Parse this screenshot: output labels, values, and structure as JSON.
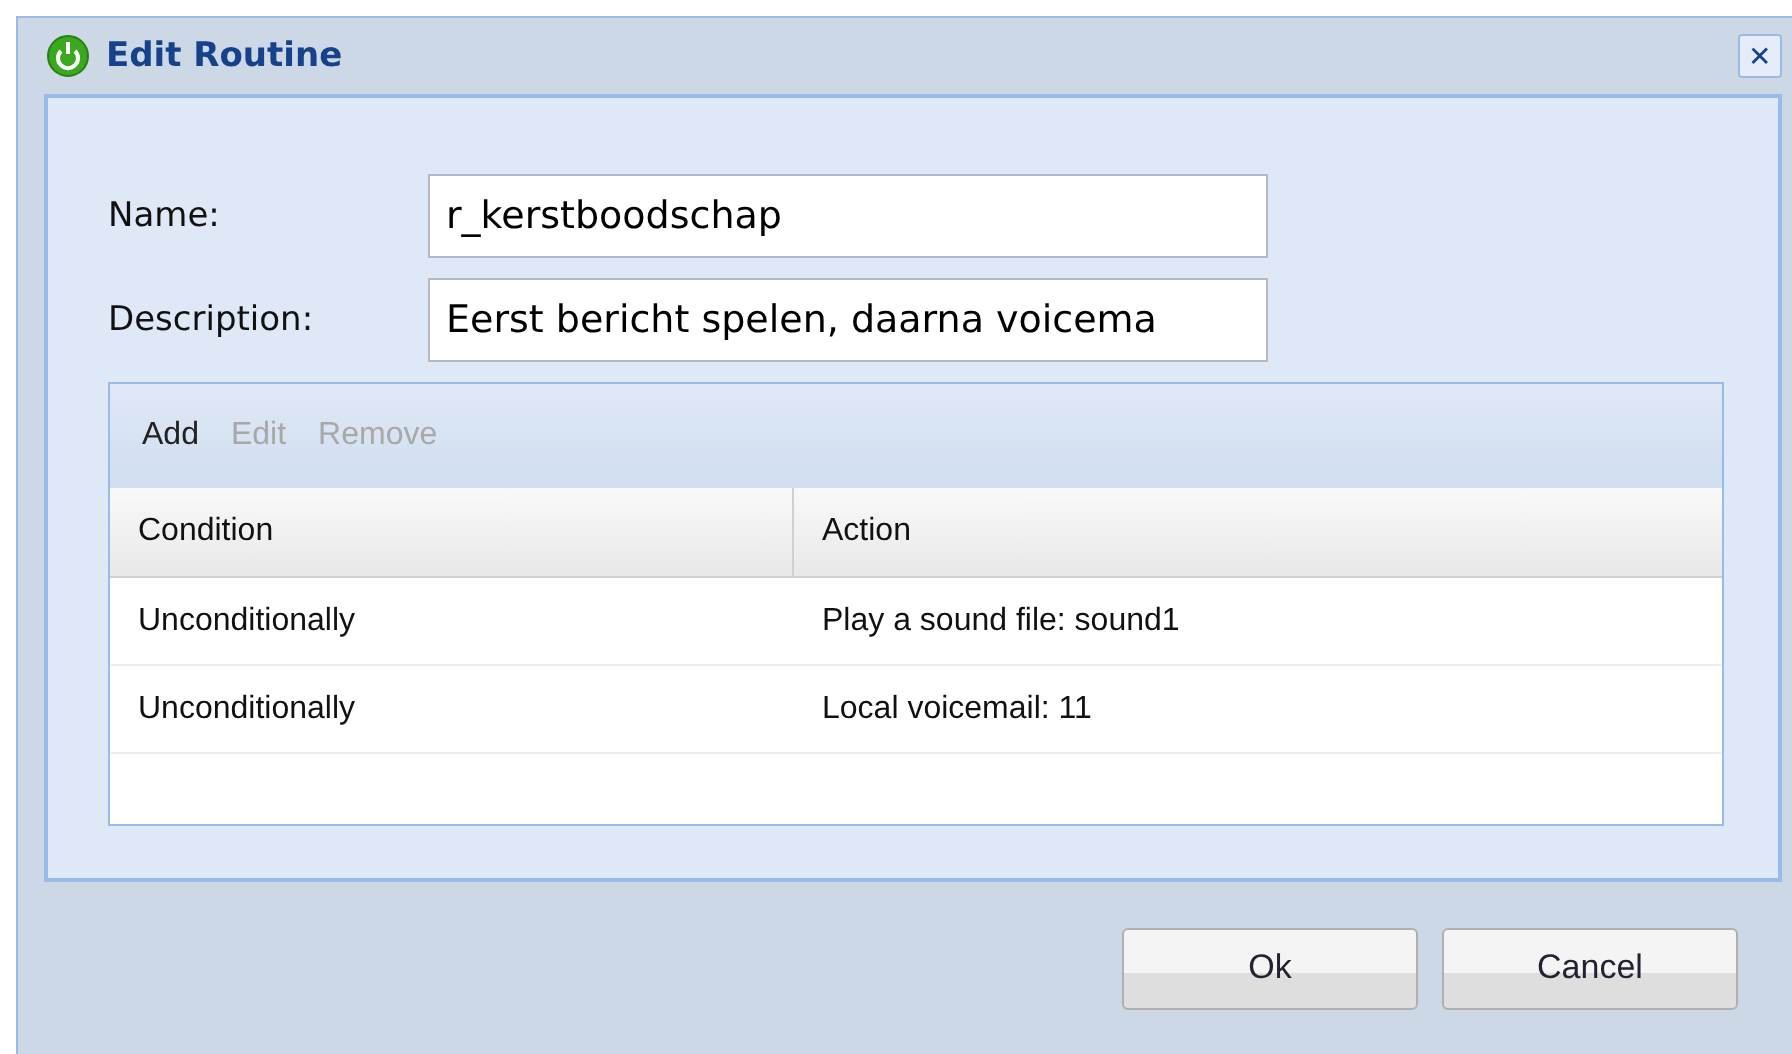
{
  "window": {
    "title": "Edit Routine",
    "close": "✕"
  },
  "form": [
    {
      "label": "Name:",
      "value": "r_kerstboodschap"
    },
    {
      "label": "Description:",
      "value": "Eerst bericht spelen, daarna voicema"
    }
  ],
  "toolbar": [
    {
      "label": "Add",
      "disabled": false
    },
    {
      "label": "Edit",
      "disabled": true
    },
    {
      "label": "Remove",
      "disabled": true
    }
  ],
  "table": {
    "columns": [
      "Condition",
      "Action"
    ],
    "rows": [
      [
        "Unconditionally",
        "Play a sound file: sound1"
      ],
      [
        "Unconditionally",
        "Local voicemail: 11"
      ]
    ]
  },
  "buttons": [
    "Ok",
    "Cancel"
  ]
}
